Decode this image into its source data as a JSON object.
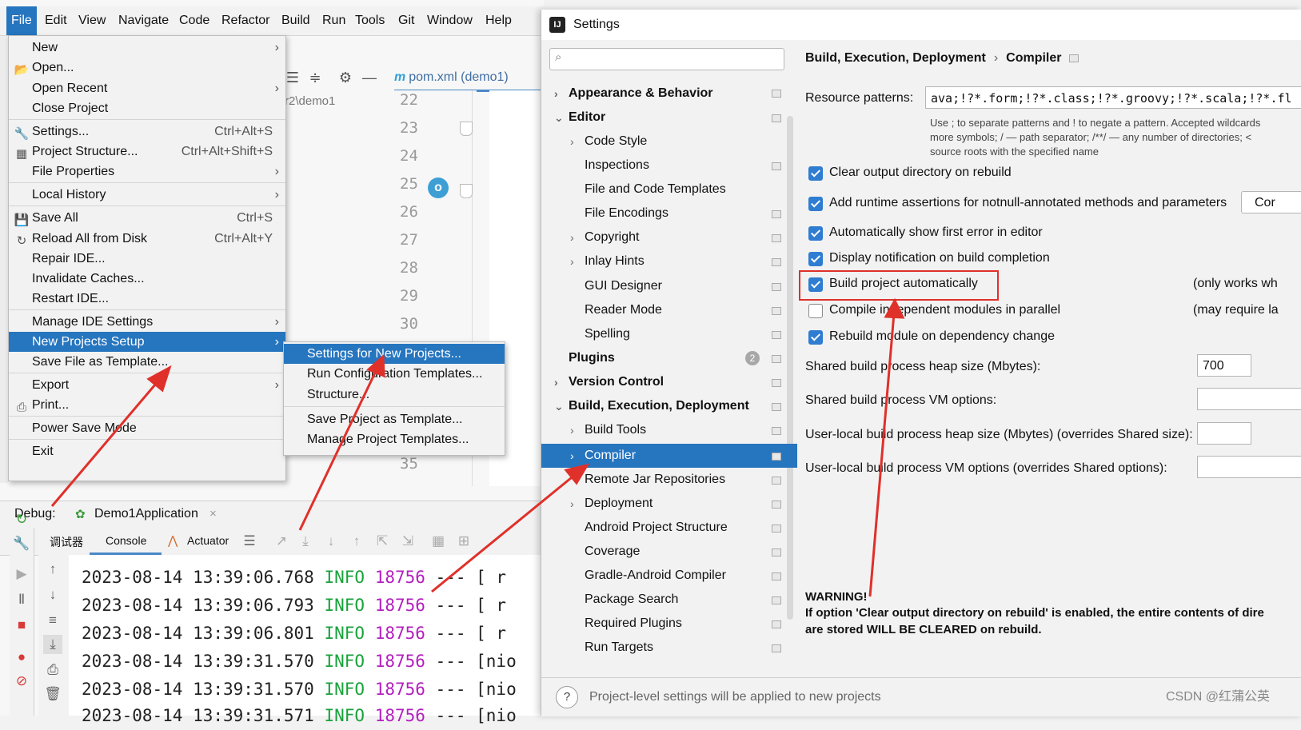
{
  "menubar": {
    "items": [
      "File",
      "Edit",
      "View",
      "Navigate",
      "Code",
      "Refactor",
      "Build",
      "Run",
      "Tools",
      "Git",
      "Window",
      "Help"
    ]
  },
  "editor": {
    "tab_label": "pom.xml (demo1)",
    "path": "r2\\demo1",
    "line_numbers": [
      "22",
      "23",
      "24",
      "25",
      "26",
      "27",
      "28",
      "29",
      "30",
      "34",
      "35"
    ]
  },
  "file_menu": {
    "new": "New",
    "open": "Open...",
    "open_recent": "Open Recent",
    "close_project": "Close Project",
    "settings": "Settings...",
    "settings_sc": "Ctrl+Alt+S",
    "project_structure": "Project Structure...",
    "project_structure_sc": "Ctrl+Alt+Shift+S",
    "file_properties": "File Properties",
    "local_history": "Local History",
    "save_all": "Save All",
    "save_all_sc": "Ctrl+S",
    "reload": "Reload All from Disk",
    "reload_sc": "Ctrl+Alt+Y",
    "repair": "Repair IDE...",
    "invalidate": "Invalidate Caches...",
    "restart": "Restart IDE...",
    "manage_ide": "Manage IDE Settings",
    "new_projects_setup": "New Projects Setup",
    "save_template": "Save File as Template...",
    "export": "Export",
    "print": "Print...",
    "power_save": "Power Save Mode",
    "exit": "Exit"
  },
  "sub_menu": {
    "settings_new": "Settings for New Projects...",
    "run_config": "Run Configuration Templates...",
    "structure": "Structure...",
    "save_project_template": "Save Project as Template...",
    "manage_templates": "Manage Project Templates..."
  },
  "debug": {
    "label": "Debug:",
    "session": "Demo1Application",
    "tab_debugger": "调试器",
    "tab_console": "Console",
    "tab_actuator": "Actuator",
    "logs": [
      {
        "ts": "2023-08-14 13:39:06.768",
        "level": "INFO",
        "pid": "18756",
        "rest": "--- [  r"
      },
      {
        "ts": "2023-08-14 13:39:06.793",
        "level": "INFO",
        "pid": "18756",
        "rest": "--- [  r"
      },
      {
        "ts": "2023-08-14 13:39:06.801",
        "level": "INFO",
        "pid": "18756",
        "rest": "--- [  r"
      },
      {
        "ts": "2023-08-14 13:39:31.570",
        "level": "INFO",
        "pid": "18756",
        "rest": "--- [nio"
      },
      {
        "ts": "2023-08-14 13:39:31.570",
        "level": "INFO",
        "pid": "18756",
        "rest": "--- [nio"
      },
      {
        "ts": "2023-08-14 13:39:31.571",
        "level": "INFO",
        "pid": "18756",
        "rest": "--- [nio"
      }
    ]
  },
  "settings": {
    "title": "Settings",
    "search_placeholder": "",
    "tree": [
      {
        "label": "Appearance & Behavior"
      },
      {
        "label": "Editor"
      },
      {
        "label": "Code Style"
      },
      {
        "label": "Inspections"
      },
      {
        "label": "File and Code Templates"
      },
      {
        "label": "File Encodings"
      },
      {
        "label": "Copyright"
      },
      {
        "label": "Inlay Hints"
      },
      {
        "label": "GUI Designer"
      },
      {
        "label": "Reader Mode"
      },
      {
        "label": "Spelling"
      },
      {
        "label": "Plugins"
      },
      {
        "label": "Version Control"
      },
      {
        "label": "Build, Execution, Deployment"
      },
      {
        "label": "Build Tools"
      },
      {
        "label": "Compiler"
      },
      {
        "label": "Remote Jar Repositories"
      },
      {
        "label": "Deployment"
      },
      {
        "label": "Android Project Structure"
      },
      {
        "label": "Coverage"
      },
      {
        "label": "Gradle-Android Compiler"
      },
      {
        "label": "Package Search"
      },
      {
        "label": "Required Plugins"
      },
      {
        "label": "Run Targets"
      }
    ],
    "plugins_badge": "2",
    "breadcrumb_parent": "Build, Execution, Deployment",
    "breadcrumb_sep": "›",
    "breadcrumb_current": "Compiler",
    "resource_patterns_label": "Resource patterns:",
    "resource_patterns_value": "ava;!?*.form;!?*.class;!?*.groovy;!?*.scala;!?*.fl",
    "hint_line1": "Use ; to separate patterns and ! to negate a pattern. Accepted wildcards",
    "hint_line2": "more symbols; / — path separator; /**/ — any number of directories; <",
    "hint_line3": "source roots with the specified name",
    "options": {
      "clear_output": "Clear output directory on rebuild",
      "runtime_assertions": "Add runtime assertions for notnull-annotated methods and parameters",
      "show_first_error": "Automatically show first error in editor",
      "notify_build": "Display notification on build completion",
      "build_auto": "Build project automatically",
      "build_auto_note": "(only works wh",
      "compile_parallel": "Compile independent modules in parallel",
      "compile_parallel_note": "(may require la",
      "rebuild_dep": "Rebuild module on dependency change"
    },
    "configure_button": "Cor",
    "heap_label": "Shared build process heap size (Mbytes):",
    "heap_value": "700",
    "vm_label": "Shared build process VM options:",
    "user_heap_label": "User-local build process heap size (Mbytes) (overrides Shared size):",
    "user_vm_label": "User-local build process VM options (overrides Shared options):",
    "warning_title": "WARNING!",
    "warning_line1": "If option 'Clear output directory on rebuild' is enabled, the entire contents of dire",
    "warning_line2": "are stored WILL BE CLEARED on rebuild.",
    "footer_text": "Project-level settings will be applied to new projects",
    "help": "?",
    "watermark": "CSDN @红蒲公英"
  },
  "colors": {
    "accent": "#2675bf",
    "arrow": "#e0302a",
    "info": "#19a23b",
    "pid": "#b31fbf"
  }
}
